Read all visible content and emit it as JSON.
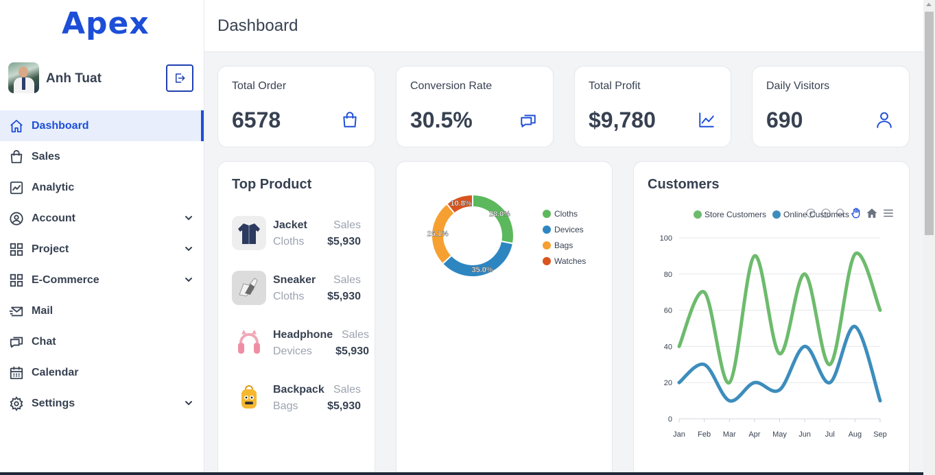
{
  "app": {
    "logo": "Apex"
  },
  "user": {
    "name": "Anh Tuat"
  },
  "header": {
    "title": "Dashboard"
  },
  "nav": [
    {
      "label": "Dashboard",
      "icon": "home-icon",
      "active": true,
      "chevron": false
    },
    {
      "label": "Sales",
      "icon": "shopping-bag-icon",
      "active": false,
      "chevron": false
    },
    {
      "label": "Analytic",
      "icon": "chart-line-icon",
      "active": false,
      "chevron": false
    },
    {
      "label": "Account",
      "icon": "user-circle-icon",
      "active": false,
      "chevron": true
    },
    {
      "label": "Project",
      "icon": "grid-icon",
      "active": false,
      "chevron": true
    },
    {
      "label": "E-Commerce",
      "icon": "grid-icon",
      "active": false,
      "chevron": true
    },
    {
      "label": "Mail",
      "icon": "mail-icon",
      "active": false,
      "chevron": false
    },
    {
      "label": "Chat",
      "icon": "chat-icon",
      "active": false,
      "chevron": false
    },
    {
      "label": "Calendar",
      "icon": "calendar-icon",
      "active": false,
      "chevron": false
    },
    {
      "label": "Settings",
      "icon": "gear-icon",
      "active": false,
      "chevron": true
    }
  ],
  "stats": [
    {
      "label": "Total Order",
      "value": "6578",
      "icon": "shopping-bag-icon"
    },
    {
      "label": "Conversion Rate",
      "value": "30.5%",
      "icon": "chat-icon"
    },
    {
      "label": "Total Profit",
      "value": "$9,780",
      "icon": "chart-line-icon"
    },
    {
      "label": "Daily Visitors",
      "value": "690",
      "icon": "user-icon"
    }
  ],
  "top_product": {
    "title": "Top Product",
    "items": [
      {
        "name": "Jacket",
        "category": "Cloths",
        "sales_label": "Sales",
        "price": "$5,930",
        "icon": "jacket-image"
      },
      {
        "name": "Sneaker",
        "category": "Cloths",
        "sales_label": "Sales",
        "price": "$5,930",
        "icon": "sneaker-image"
      },
      {
        "name": "Headphone",
        "category": "Devices",
        "sales_label": "Sales",
        "price": "$5,930",
        "icon": "headphone-image"
      },
      {
        "name": "Backpack",
        "category": "Bags",
        "sales_label": "Sales",
        "price": "$5,930",
        "icon": "backpack-image"
      }
    ]
  },
  "colors": {
    "accent": "#1d4ed8",
    "cloths": "#5cb85c",
    "devices": "#2e86c1",
    "bags": "#f5a030",
    "watches": "#d9541e",
    "store": "#6dbb6d",
    "online": "#3c8dbc"
  },
  "customers": {
    "title": "Customers",
    "toolbar": [
      "zoom-in-icon",
      "zoom-out-icon",
      "magnify-icon",
      "pan-hand-icon",
      "home-icon",
      "menu-icon"
    ]
  },
  "chart_data": [
    {
      "type": "pie",
      "variant": "donut",
      "labels": [
        "Cloths",
        "Devices",
        "Bags",
        "Watches"
      ],
      "values": [
        28.0,
        35.0,
        26.1,
        10.8
      ],
      "data_labels": [
        "28.0%",
        "35.0%",
        "26.1%",
        "10.8%"
      ],
      "legend": "right"
    },
    {
      "type": "line",
      "title": "Customers",
      "categories": [
        "Jan",
        "Feb",
        "Mar",
        "Apr",
        "May",
        "Jun",
        "Jul",
        "Aug",
        "Sep"
      ],
      "series": [
        {
          "name": "Store Customers",
          "values": [
            40,
            70,
            20,
            90,
            36,
            80,
            30,
            91,
            60
          ]
        },
        {
          "name": "Online Customers",
          "values": [
            20,
            30,
            10,
            20,
            16,
            40,
            20,
            51,
            10
          ]
        }
      ],
      "ylim": [
        0,
        100
      ],
      "yticks": [
        0,
        20,
        40,
        60,
        80,
        100
      ],
      "smooth": true,
      "grid": true,
      "legend": "top"
    }
  ]
}
